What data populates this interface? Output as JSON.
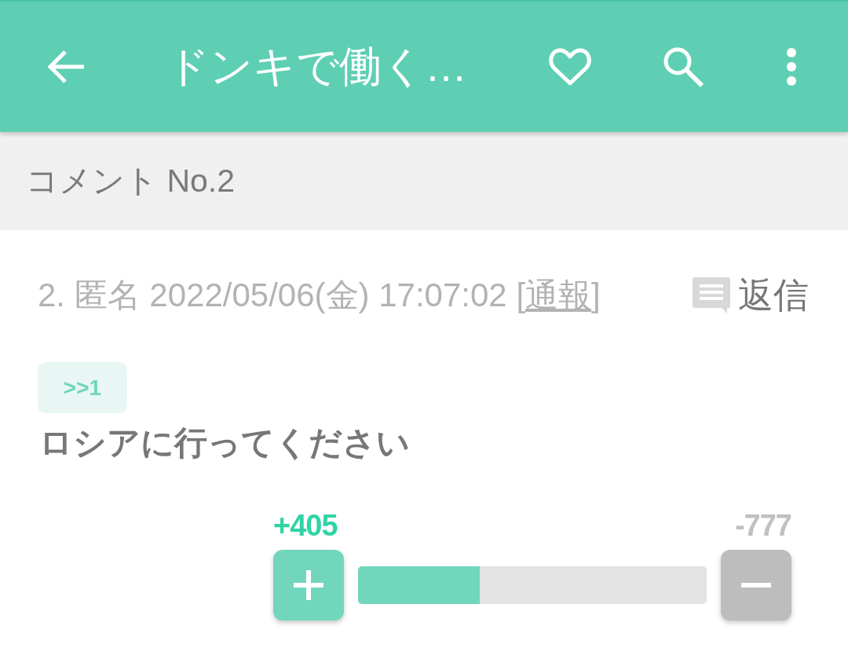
{
  "app_bar": {
    "title": "ドンキで働く…"
  },
  "section_header": {
    "label": "コメント No.2"
  },
  "comment": {
    "meta": "2. 匿名 2022/05/06(金) 17:07:02",
    "report": {
      "before": "[",
      "link": "通報",
      "after": "]"
    },
    "reply_button": "返信",
    "anchor": ">>1",
    "body": "ロシアに行ってください",
    "votes": {
      "plus_count": "+405",
      "minus_count": "-777",
      "level": 0.35
    }
  }
}
